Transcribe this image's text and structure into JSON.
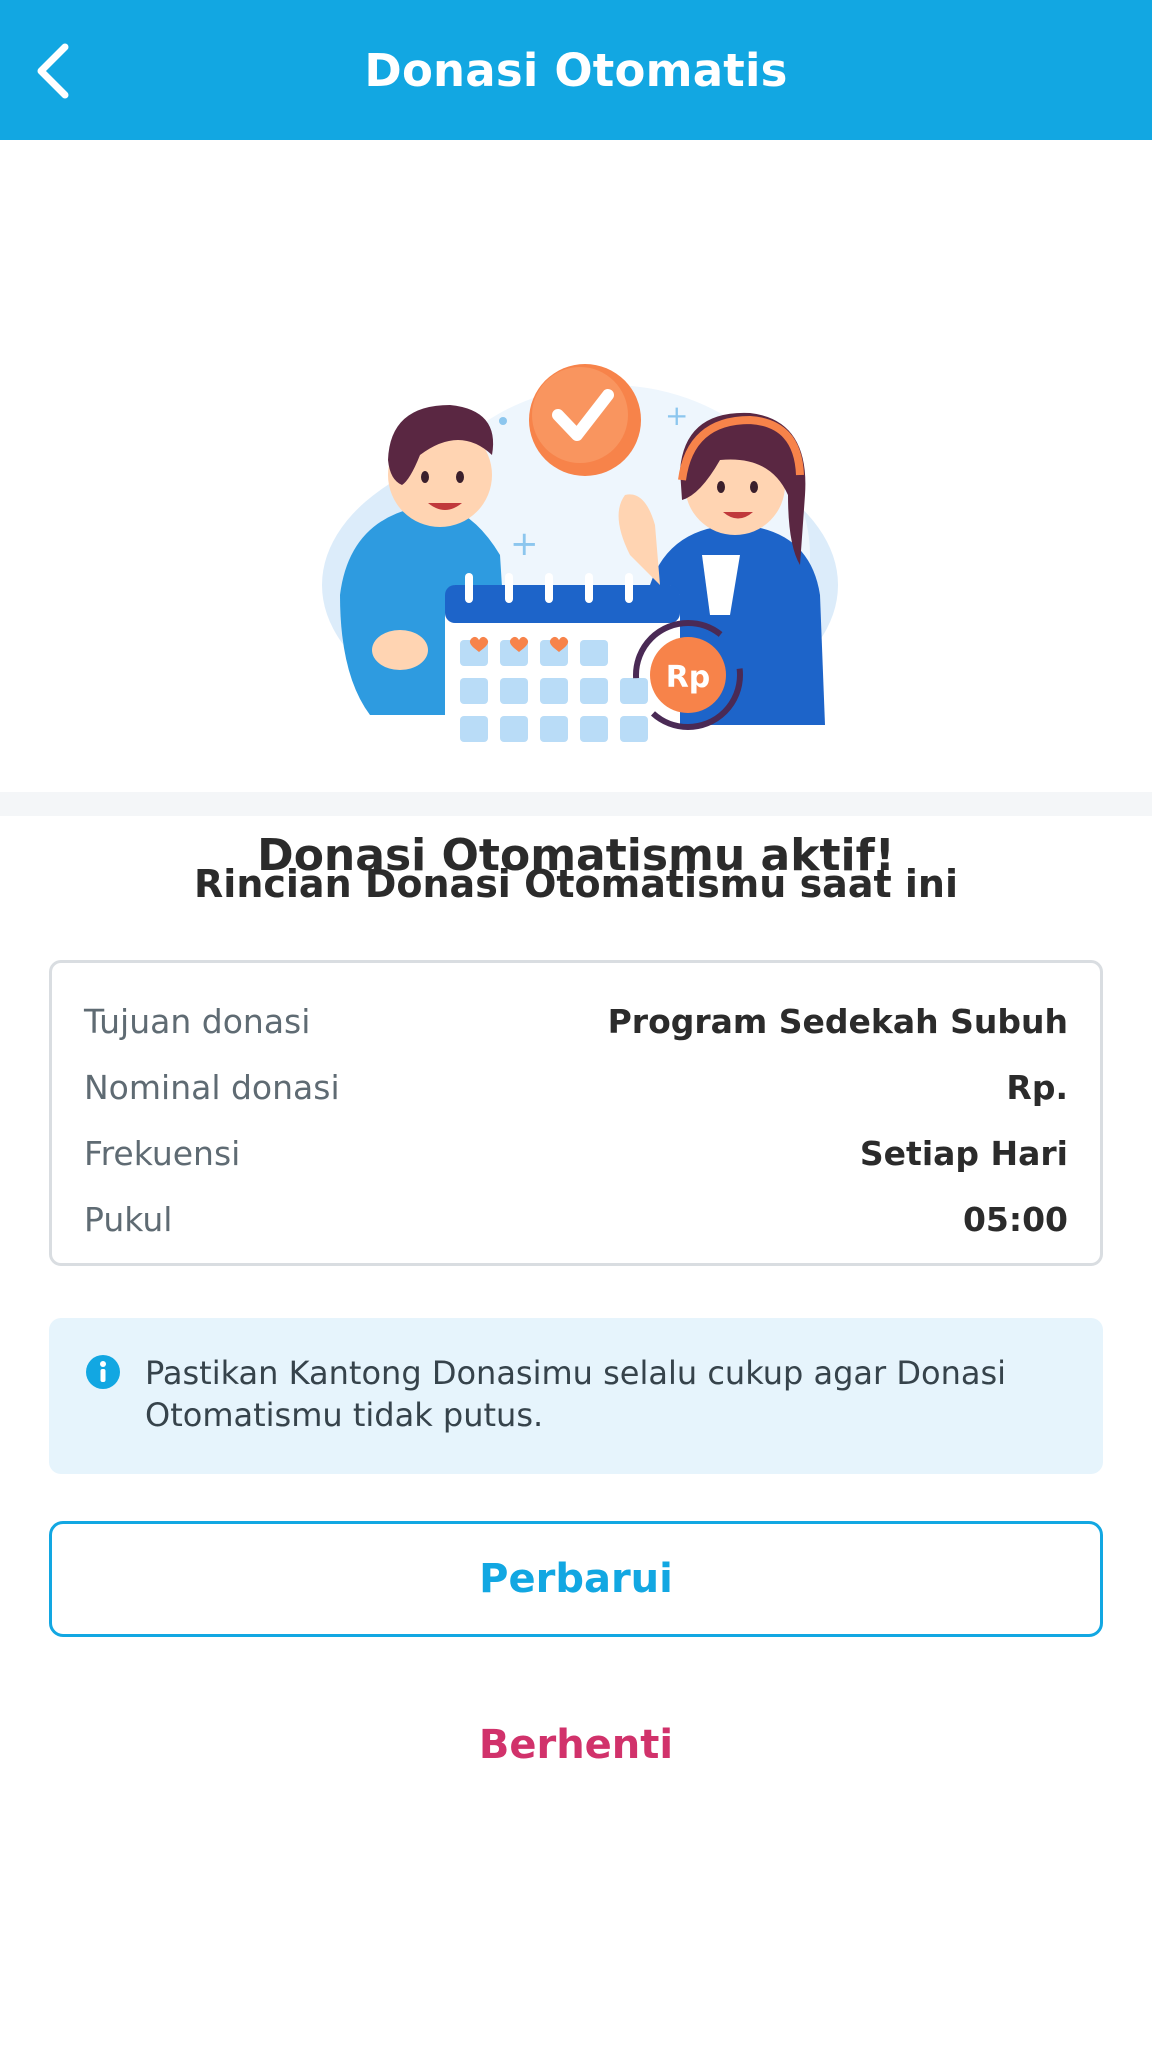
{
  "appbar": {
    "title": "Donasi Otomatis",
    "back_icon": "chevron-left-icon",
    "background_color": "#12a7e2"
  },
  "hero": {
    "illustration": "two-people-calendar-rupiah-checkmark-illustration",
    "badge_text": "Rp",
    "title": "Donasi Otomatismu aktif!"
  },
  "details": {
    "section_title": "Rincian Donasi Otomatismu saat ini",
    "rows": [
      {
        "label": "Tujuan donasi",
        "value": "Program Sedekah Subuh"
      },
      {
        "label": "Nominal donasi",
        "value": "Rp."
      },
      {
        "label": "Frekuensi",
        "value": "Setiap Hari"
      },
      {
        "label": "Pukul",
        "value": "05:00"
      }
    ]
  },
  "notice": {
    "icon": "info-icon",
    "text": "Pastikan Kantong Donasimu selalu cukup agar Donasi Otomatismu tidak putus."
  },
  "actions": {
    "update_label": "Perbarui",
    "stop_label": "Berhenti",
    "update_color": "#12a7e2",
    "stop_color": "#d1326b"
  }
}
